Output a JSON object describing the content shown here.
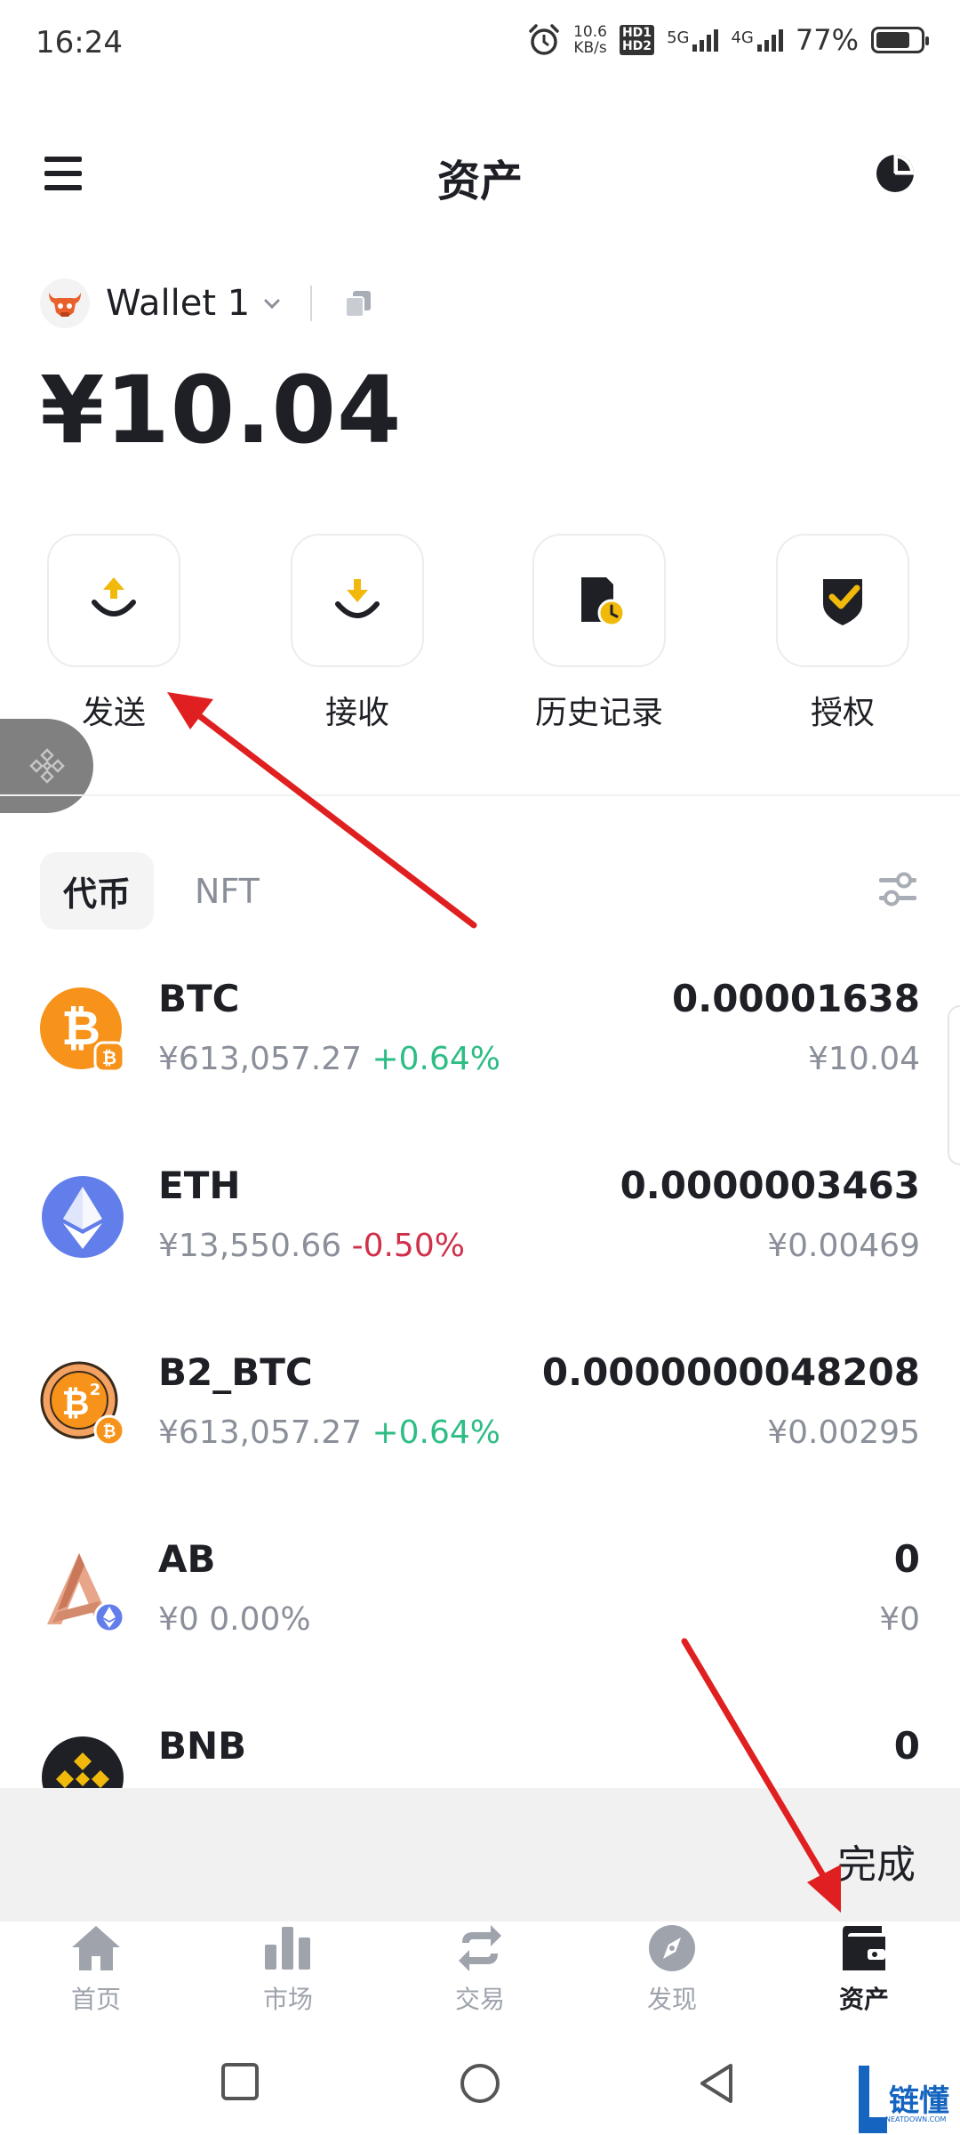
{
  "status_bar": {
    "time": "16:24",
    "net_speed_value": "10.6",
    "net_speed_unit": "KB/s",
    "hd1": "HD1",
    "hd2": "HD2",
    "sim1": "5G",
    "sim2": "4G",
    "battery": "77%",
    "battery_level": 0.77
  },
  "header": {
    "title": "资产",
    "menu_icon": "hamburger-menu-icon",
    "right_icon": "pie-chart-icon"
  },
  "wallet": {
    "name": "Wallet 1",
    "balance": "¥10.04"
  },
  "actions": [
    {
      "label": "发送",
      "icon": "send-icon"
    },
    {
      "label": "接收",
      "icon": "receive-icon"
    },
    {
      "label": "历史记录",
      "icon": "history-icon"
    },
    {
      "label": "授权",
      "icon": "approval-icon"
    }
  ],
  "tabs": [
    {
      "label": "代币",
      "active": true
    },
    {
      "label": "NFT",
      "active": false
    }
  ],
  "tokens": [
    {
      "symbol": "BTC",
      "price": "¥613,057.27",
      "change": "+0.64%",
      "amount": "0.00001638",
      "value": "¥10.04"
    },
    {
      "symbol": "ETH",
      "price": "¥13,550.66",
      "change": "-0.50%",
      "amount": "0.0000003463",
      "value": "¥0.00469"
    },
    {
      "symbol": "B2_BTC",
      "price": "¥613,057.27",
      "change": "+0.64%",
      "amount": "0.0000000048208",
      "value": "¥0.00295"
    },
    {
      "symbol": "AB",
      "price": "¥0",
      "change": "0.00%",
      "amount": "0",
      "value": "¥0"
    },
    {
      "symbol": "BNB",
      "price": "",
      "change": "",
      "amount": "0",
      "value": ""
    }
  ],
  "done_bar": {
    "label": "完成"
  },
  "bottom_nav": [
    {
      "label": "首页",
      "icon": "home-icon",
      "active": false
    },
    {
      "label": "市场",
      "icon": "market-bars-icon",
      "active": false
    },
    {
      "label": "交易",
      "icon": "swap-icon",
      "active": false
    },
    {
      "label": "发现",
      "icon": "compass-icon",
      "active": false
    },
    {
      "label": "资产",
      "icon": "wallet-icon",
      "active": true
    }
  ],
  "watermark": {
    "text": "链懂",
    "sub": "NEATDOWN.COM"
  },
  "colors": {
    "accent": "#f0b90b",
    "up": "#2ebd85",
    "down": "#cf304a",
    "annotation_arrow": "#e02020"
  }
}
